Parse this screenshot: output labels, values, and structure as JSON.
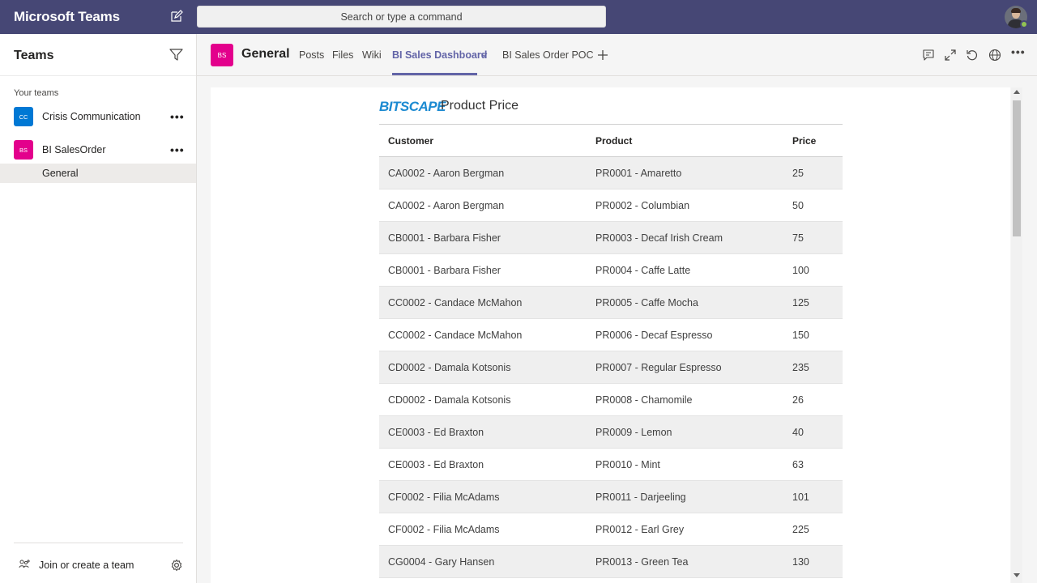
{
  "app": {
    "title": "Microsoft Teams"
  },
  "search": {
    "placeholder": "Search or type a command"
  },
  "sidebar": {
    "title": "Teams",
    "section_label": "Your teams",
    "teams": [
      {
        "initials": "CC",
        "name": "Crisis Communication",
        "color": "#0078d4"
      },
      {
        "initials": "BS",
        "name": "BI SalesOrder",
        "color": "#e3008c"
      }
    ],
    "selected_channel": "General",
    "join_label": "Join or create a team"
  },
  "channel": {
    "initials": "BS",
    "title": "General",
    "tabs": [
      "Posts",
      "Files",
      "Wiki",
      "BI Sales Dashboard",
      "BI Sales Order POC"
    ],
    "active_tab": "BI Sales Dashboard"
  },
  "report": {
    "brand": "BITSCAPE",
    "title": "Product Price",
    "columns": [
      "Customer",
      "Product",
      "Price"
    ],
    "rows": [
      [
        "CA0002 - Aaron Bergman",
        "PR0001 - Amaretto",
        "25"
      ],
      [
        "CA0002 - Aaron Bergman",
        "PR0002 - Columbian",
        "50"
      ],
      [
        "CB0001 - Barbara Fisher",
        "PR0003 - Decaf Irish Cream",
        "75"
      ],
      [
        "CB0001 - Barbara Fisher",
        "PR0004 - Caffe Latte",
        "100"
      ],
      [
        "CC0002 - Candace McMahon",
        "PR0005 - Caffe Mocha",
        "125"
      ],
      [
        "CC0002 - Candace McMahon",
        "PR0006 - Decaf Espresso",
        "150"
      ],
      [
        "CD0002 - Damala Kotsonis",
        "PR0007 - Regular Espresso",
        "235"
      ],
      [
        "CD0002 - Damala Kotsonis",
        "PR0008 - Chamomile",
        "26"
      ],
      [
        "CE0003 - Ed Braxton",
        "PR0009 - Lemon",
        "40"
      ],
      [
        "CE0003 - Ed Braxton",
        "PR0010 - Mint",
        "63"
      ],
      [
        "CF0002 - Filia McAdams",
        "PR0011 - Darjeeling",
        "101"
      ],
      [
        "CF0002 - Filia McAdams",
        "PR0012 - Earl Grey",
        "225"
      ],
      [
        "CG0004 - Gary Hansen",
        "PR0013 - Green Tea",
        "130"
      ]
    ]
  },
  "colors": {
    "topbar": "#464775",
    "accent": "#6264a7",
    "brand": "#1c8ad1"
  }
}
